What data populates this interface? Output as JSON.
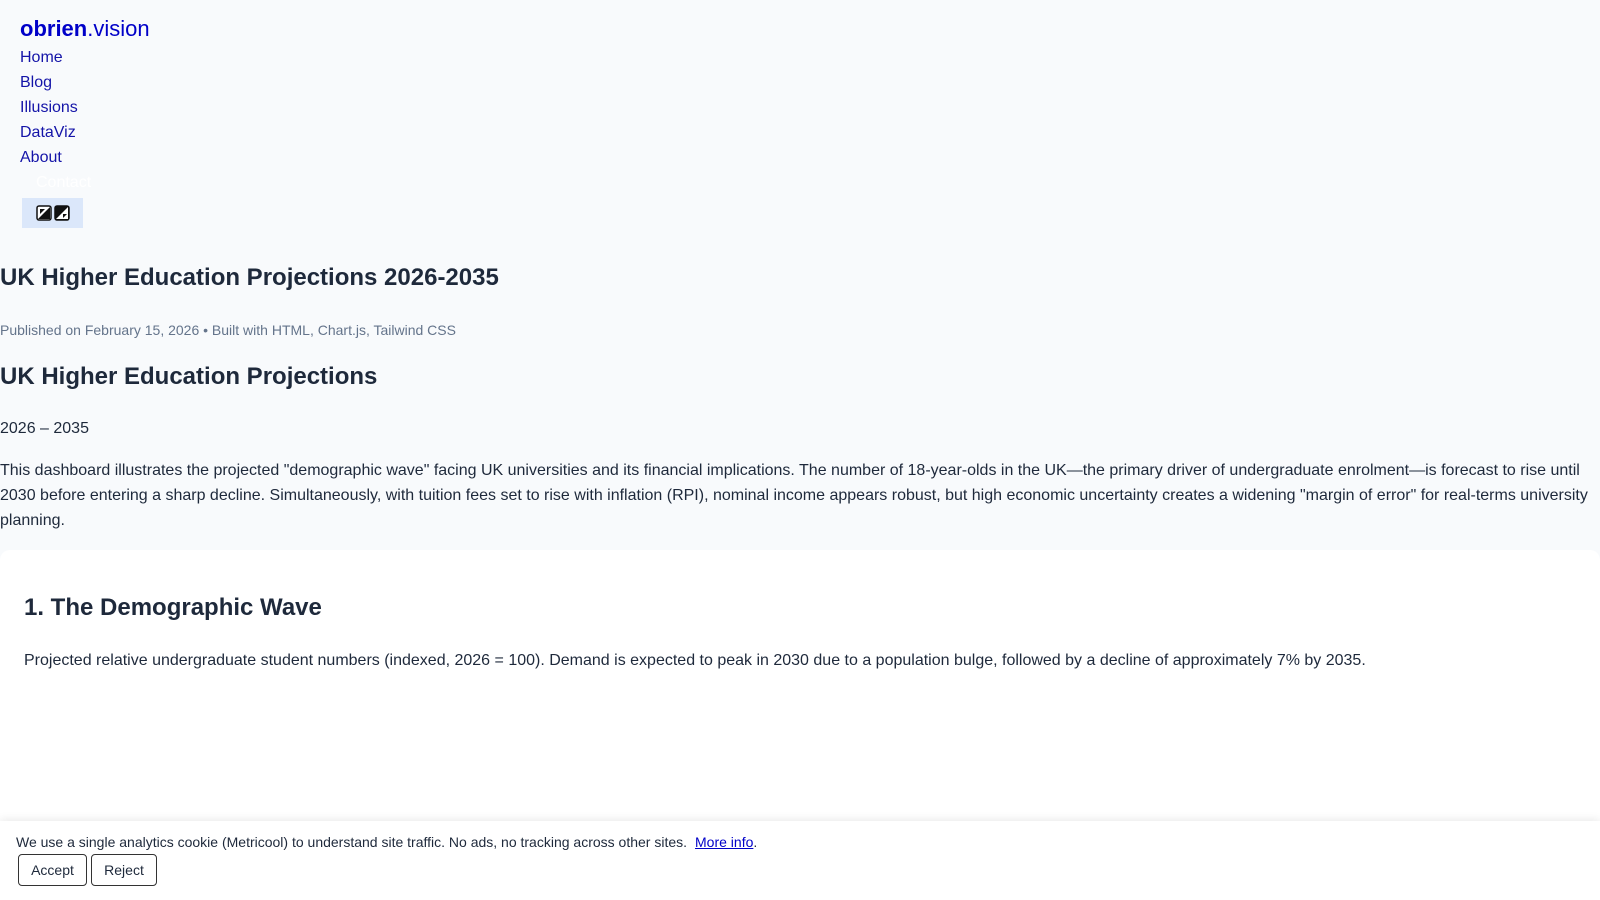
{
  "site": {
    "brand_bold": "obrien",
    "brand_rest": ".vision",
    "nav": [
      "Home",
      "Blog",
      "Illusions",
      "DataViz",
      "About",
      "Contact"
    ],
    "theme_toggle_icons": [
      "sun-icon",
      "moon-icon"
    ]
  },
  "article": {
    "title": "UK Higher Education Projections 2026-2035",
    "meta": "Published on February 15, 2026 • Built with HTML, Chart.js, Tailwind CSS",
    "heading": "UK Higher Education Projections",
    "range": "2026 – 2035",
    "intro": "This dashboard illustrates the projected \"demographic wave\" facing UK universities and its financial implications. The number of 18-year-olds in the UK—the primary driver of undergraduate enrolment—is forecast to rise until 2030 before entering a sharp decline. Simultaneously, with tuition fees set to rise with inflation (RPI), nominal income appears robust, but high economic uncertainty creates a widening \"margin of error\" for real-terms university planning."
  },
  "section1": {
    "title": "1. The Demographic Wave",
    "description": "Projected relative undergraduate student numbers (indexed, 2026 = 100). Demand is expected to peak in 2030 due to a population bulge, followed by a decline of approximately 7% by 2035."
  },
  "cookie": {
    "text": "We use a single analytics cookie (Metricool) to understand site traffic. No ads, no tracking across other sites.",
    "link": "More info",
    "link_suffix": ".",
    "accept": "Accept",
    "reject": "Reject"
  },
  "colors": {
    "brand": "#0000c8",
    "nav_link": "#1414a8",
    "page_bg": "#f8fafc",
    "toggle_bg": "#dbe7fa"
  }
}
